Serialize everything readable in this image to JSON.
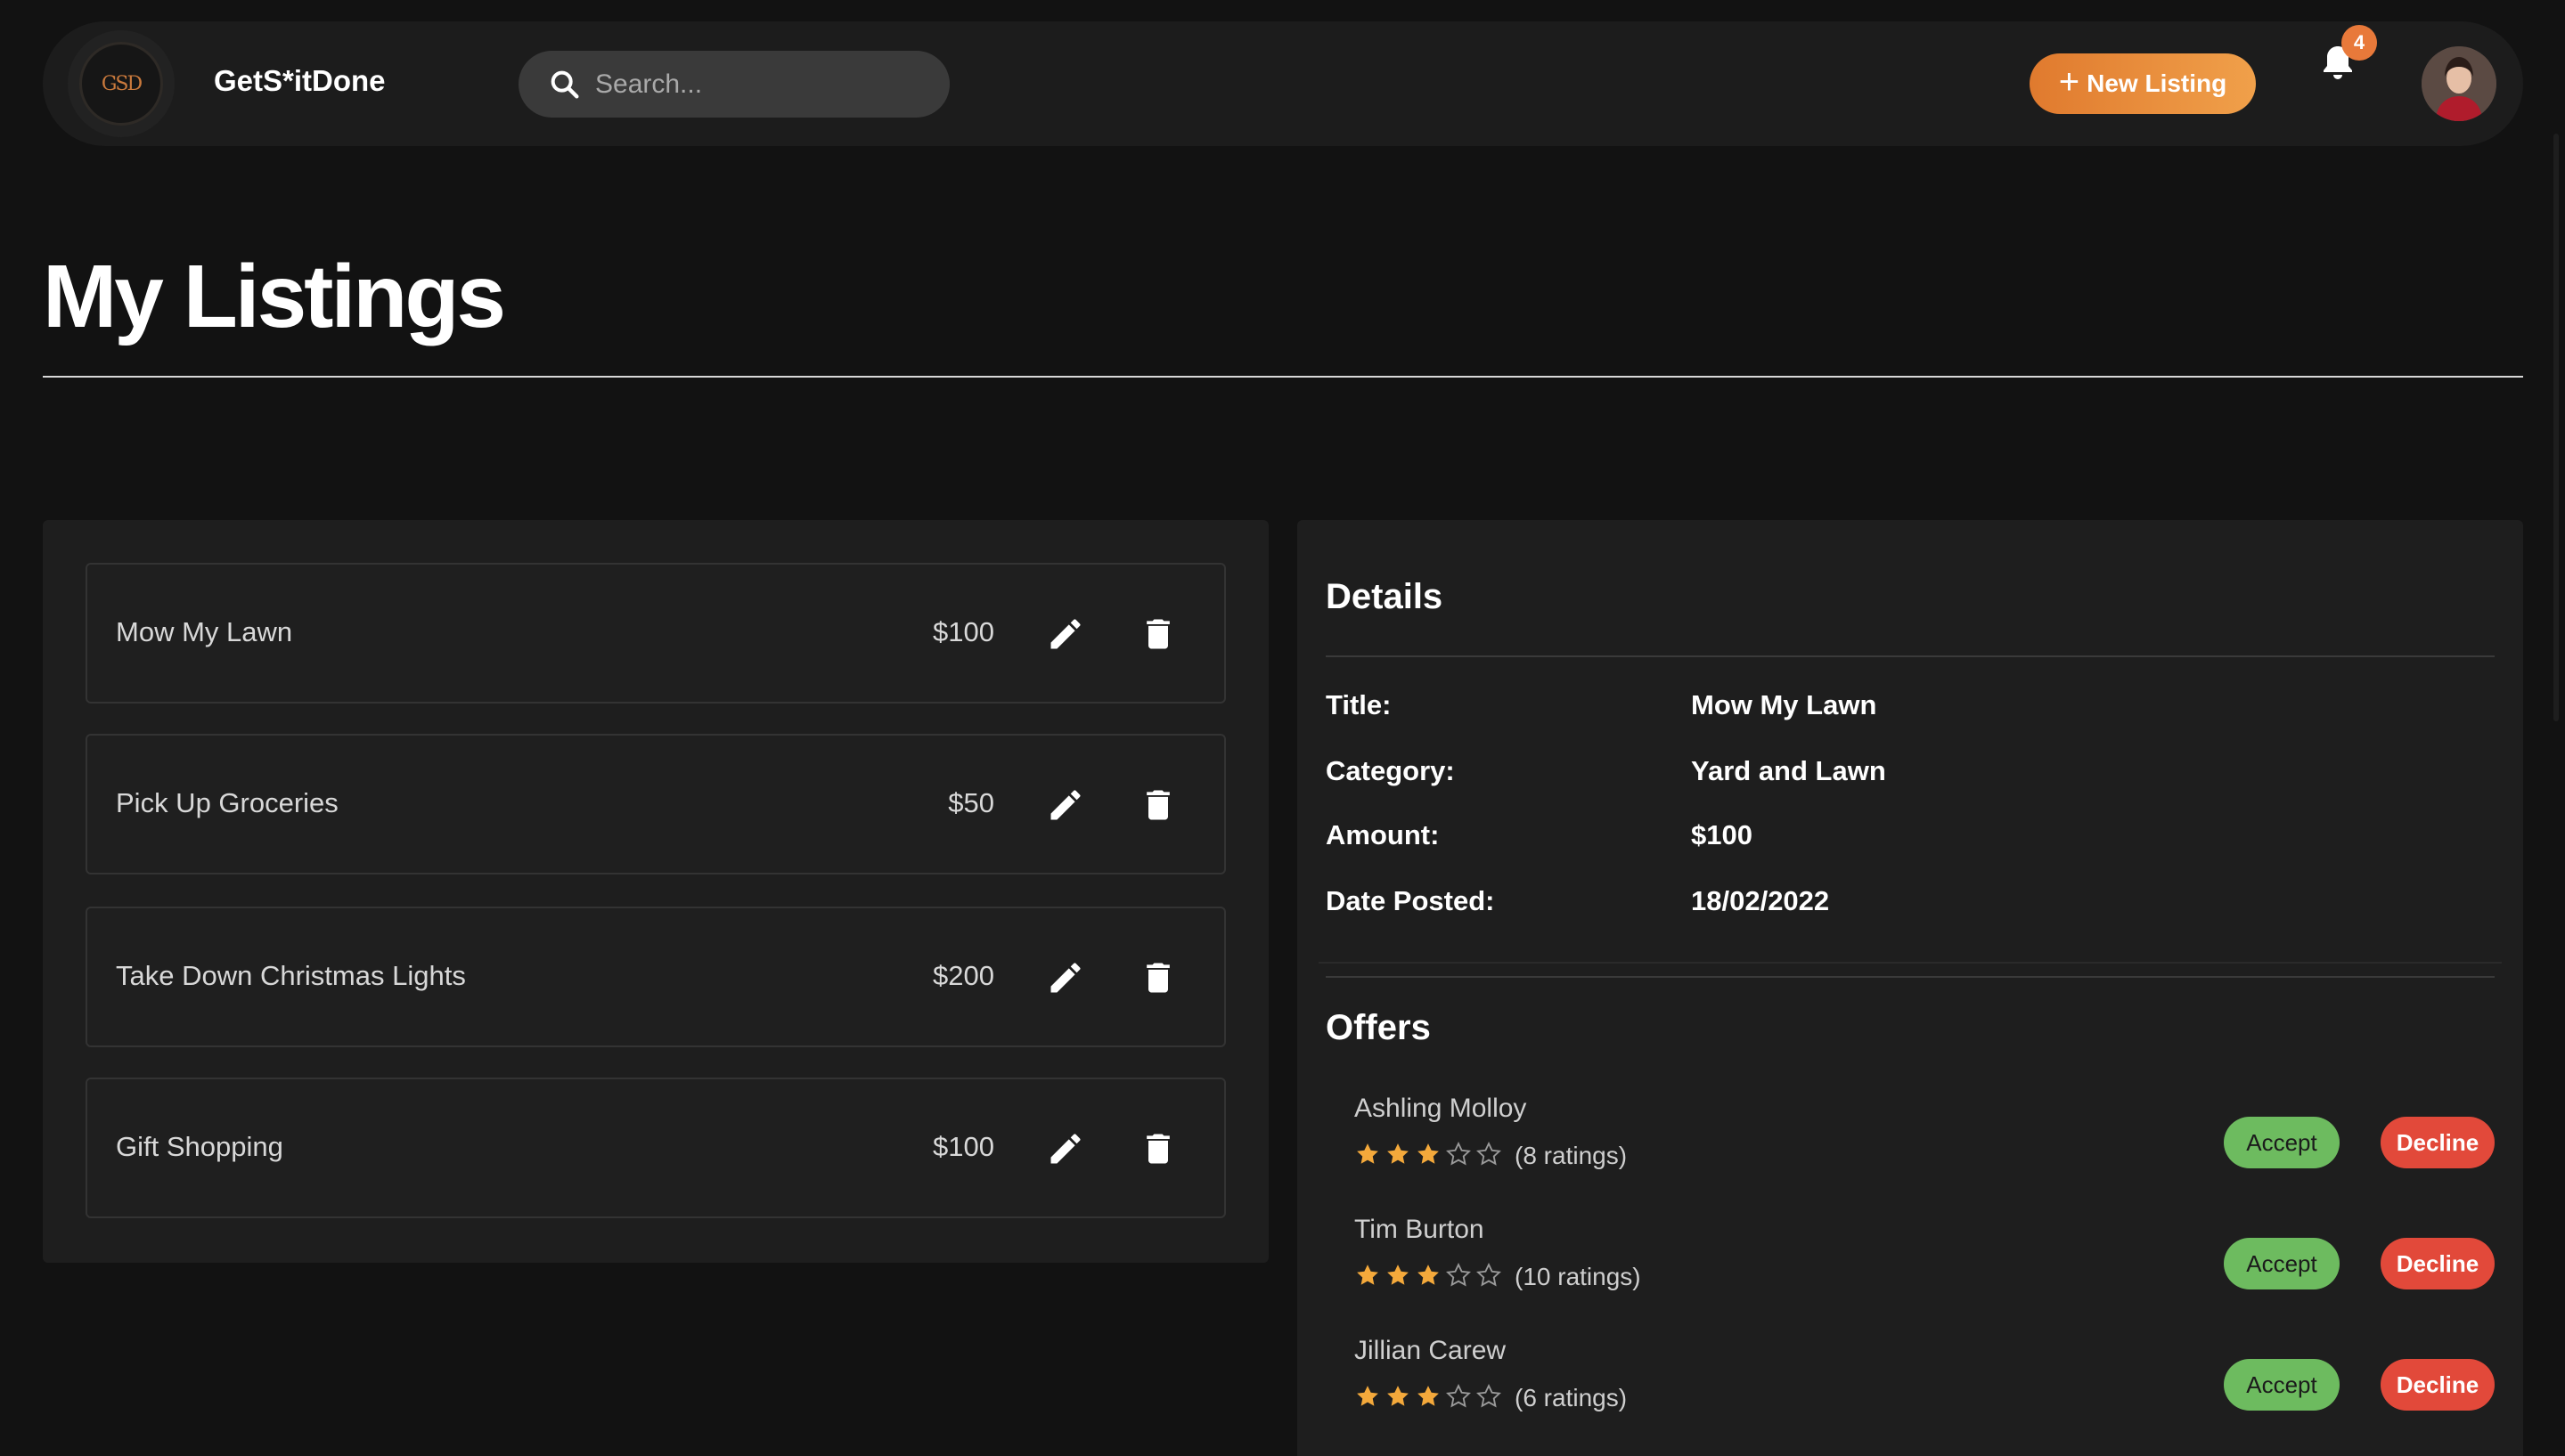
{
  "header": {
    "logo_text": "GSD",
    "brand": "GetS*itDone",
    "search_placeholder": "Search...",
    "new_listing_label": "New Listing",
    "notification_count": "4"
  },
  "page": {
    "title": "My Listings"
  },
  "listings": [
    {
      "title": "Mow My Lawn",
      "price": "$100"
    },
    {
      "title": "Pick Up Groceries",
      "price": "$50"
    },
    {
      "title": "Take Down Christmas Lights",
      "price": "$200"
    },
    {
      "title": "Gift Shopping",
      "price": "$100"
    }
  ],
  "details": {
    "heading": "Details",
    "rows": [
      {
        "label": "Title:",
        "value": "Mow My Lawn"
      },
      {
        "label": "Category:",
        "value": "Yard and Lawn"
      },
      {
        "label": "Amount:",
        "value": "$100"
      },
      {
        "label": "Date Posted:",
        "value": "18/02/2022"
      }
    ]
  },
  "offers": {
    "heading": "Offers",
    "accept_label": "Accept",
    "decline_label": "Decline",
    "items": [
      {
        "name": "Ashling Molloy",
        "rating": 3,
        "max_rating": 5,
        "ratings_text": "(8 ratings)"
      },
      {
        "name": "Tim Burton",
        "rating": 3,
        "max_rating": 5,
        "ratings_text": "(10 ratings)"
      },
      {
        "name": "Jillian Carew",
        "rating": 3,
        "max_rating": 5,
        "ratings_text": "(6 ratings)"
      }
    ]
  },
  "colors": {
    "background": "#121212",
    "accent_orange": "#e8793a",
    "accept_green": "#6dbb5f",
    "decline_red": "#e2493a",
    "star_filled": "#f4a93b"
  }
}
